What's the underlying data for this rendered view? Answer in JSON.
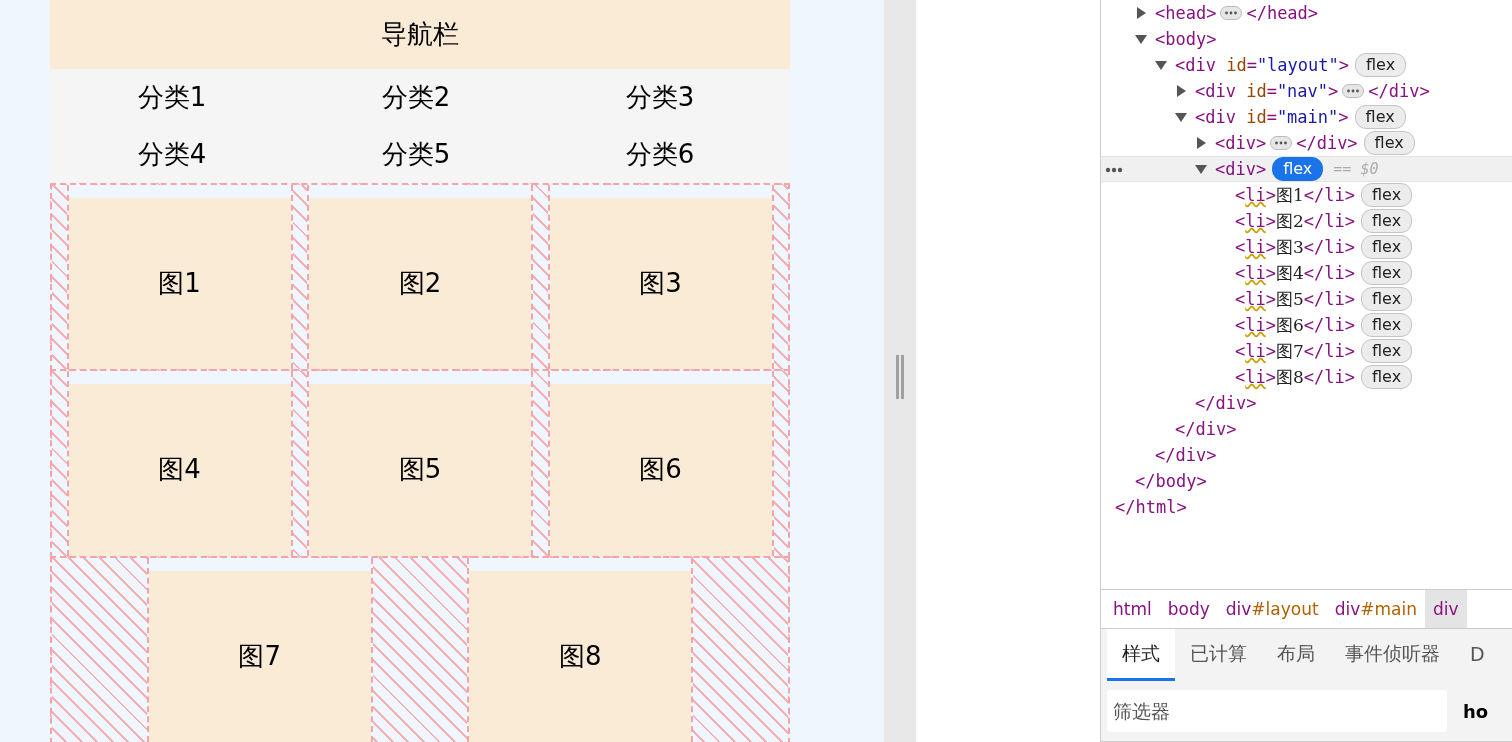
{
  "page": {
    "nav": {
      "title": "导航栏"
    },
    "categories": [
      "分类1",
      "分类2",
      "分类3",
      "分类4",
      "分类5",
      "分类6"
    ],
    "grid_rows": [
      {
        "items": [
          "图1",
          "图2",
          "图3"
        ]
      },
      {
        "items": [
          "图4",
          "图5",
          "图6"
        ]
      },
      {
        "items": [
          "图7",
          "图8"
        ]
      }
    ]
  },
  "devtools": {
    "dom_tree": [
      {
        "end": [
          {
            "t": "</html>",
            "kind": "tag"
          }
        ],
        "children": [
          {
            "open": [
              {
                "t": "<head>",
                "kind": "tag"
              }
            ],
            "expanded": false,
            "close": [
              {
                "t": "</head>",
                "kind": "tag"
              }
            ]
          },
          {
            "open": [
              {
                "t": "<body>",
                "kind": "tag"
              }
            ],
            "expanded": true,
            "end": [
              {
                "t": "</body>",
                "kind": "tag"
              }
            ],
            "children": [
              {
                "open": [
                  {
                    "t": "<div",
                    "kind": "tag"
                  },
                  {
                    "t": "id",
                    "kind": "attr"
                  },
                  {
                    "t": "=",
                    "kind": "tag"
                  },
                  {
                    "t": "\"layout\"",
                    "kind": "val"
                  },
                  {
                    "t": ">",
                    "kind": "tag"
                  }
                ],
                "badge": {
                  "label": "flex",
                  "selected": false
                },
                "expanded": true,
                "end": [
                  {
                    "t": "</div>",
                    "kind": "tag"
                  }
                ],
                "children": [
                  {
                    "open": [
                      {
                        "t": "<div",
                        "kind": "tag"
                      },
                      {
                        "t": "id",
                        "kind": "attr"
                      },
                      {
                        "t": "=",
                        "kind": "tag"
                      },
                      {
                        "t": "\"nav\"",
                        "kind": "val"
                      },
                      {
                        "t": ">",
                        "kind": "tag"
                      }
                    ],
                    "expanded": false,
                    "close": [
                      {
                        "t": "</div>",
                        "kind": "tag"
                      }
                    ]
                  },
                  {
                    "open": [
                      {
                        "t": "<div",
                        "kind": "tag"
                      },
                      {
                        "t": "id",
                        "kind": "attr"
                      },
                      {
                        "t": "=",
                        "kind": "tag"
                      },
                      {
                        "t": "\"main\"",
                        "kind": "val"
                      },
                      {
                        "t": ">",
                        "kind": "tag"
                      }
                    ],
                    "badge": {
                      "label": "flex",
                      "selected": false
                    },
                    "expanded": true,
                    "end": [
                      {
                        "t": "</div>",
                        "kind": "tag"
                      }
                    ],
                    "children": [
                      {
                        "open": [
                          {
                            "t": "<div>",
                            "kind": "tag"
                          }
                        ],
                        "expanded": false,
                        "close": [
                          {
                            "t": "</div>",
                            "kind": "tag"
                          }
                        ],
                        "badge": {
                          "label": "flex",
                          "selected": false
                        }
                      },
                      {
                        "open": [
                          {
                            "t": "<div>",
                            "kind": "tag"
                          }
                        ],
                        "badge": {
                          "label": "flex",
                          "selected": true
                        },
                        "ref": "== $0",
                        "selected": true,
                        "expanded": true,
                        "end": [
                          {
                            "t": "</div>",
                            "kind": "tag"
                          }
                        ],
                        "children": [
                          {
                            "open": [
                              {
                                "t": "<",
                                "kind": "tag"
                              },
                              {
                                "t": "li",
                                "kind": "tag",
                                "warn": true
                              },
                              {
                                "t": ">",
                                "kind": "tag"
                              },
                              {
                                "t": "图1",
                                "kind": "text"
                              },
                              {
                                "t": "</li>",
                                "kind": "tag"
                              }
                            ],
                            "badge": {
                              "label": "flex",
                              "selected": false
                            }
                          },
                          {
                            "open": [
                              {
                                "t": "<",
                                "kind": "tag"
                              },
                              {
                                "t": "li",
                                "kind": "tag",
                                "warn": true
                              },
                              {
                                "t": ">",
                                "kind": "tag"
                              },
                              {
                                "t": "图2",
                                "kind": "text"
                              },
                              {
                                "t": "</li>",
                                "kind": "tag"
                              }
                            ],
                            "badge": {
                              "label": "flex",
                              "selected": false
                            }
                          },
                          {
                            "open": [
                              {
                                "t": "<",
                                "kind": "tag"
                              },
                              {
                                "t": "li",
                                "kind": "tag",
                                "warn": true
                              },
                              {
                                "t": ">",
                                "kind": "tag"
                              },
                              {
                                "t": "图3",
                                "kind": "text"
                              },
                              {
                                "t": "</li>",
                                "kind": "tag"
                              }
                            ],
                            "badge": {
                              "label": "flex",
                              "selected": false
                            }
                          },
                          {
                            "open": [
                              {
                                "t": "<",
                                "kind": "tag"
                              },
                              {
                                "t": "li",
                                "kind": "tag",
                                "warn": true
                              },
                              {
                                "t": ">",
                                "kind": "tag"
                              },
                              {
                                "t": "图4",
                                "kind": "text"
                              },
                              {
                                "t": "</li>",
                                "kind": "tag"
                              }
                            ],
                            "badge": {
                              "label": "flex",
                              "selected": false
                            }
                          },
                          {
                            "open": [
                              {
                                "t": "<",
                                "kind": "tag"
                              },
                              {
                                "t": "li",
                                "kind": "tag",
                                "warn": true
                              },
                              {
                                "t": ">",
                                "kind": "tag"
                              },
                              {
                                "t": "图5",
                                "kind": "text"
                              },
                              {
                                "t": "</li>",
                                "kind": "tag"
                              }
                            ],
                            "badge": {
                              "label": "flex",
                              "selected": false
                            }
                          },
                          {
                            "open": [
                              {
                                "t": "<",
                                "kind": "tag"
                              },
                              {
                                "t": "li",
                                "kind": "tag",
                                "warn": true
                              },
                              {
                                "t": ">",
                                "kind": "tag"
                              },
                              {
                                "t": "图6",
                                "kind": "text"
                              },
                              {
                                "t": "</li>",
                                "kind": "tag"
                              }
                            ],
                            "badge": {
                              "label": "flex",
                              "selected": false
                            }
                          },
                          {
                            "open": [
                              {
                                "t": "<",
                                "kind": "tag"
                              },
                              {
                                "t": "li",
                                "kind": "tag",
                                "warn": true
                              },
                              {
                                "t": ">",
                                "kind": "tag"
                              },
                              {
                                "t": "图7",
                                "kind": "text"
                              },
                              {
                                "t": "</li>",
                                "kind": "tag"
                              }
                            ],
                            "badge": {
                              "label": "flex",
                              "selected": false
                            }
                          },
                          {
                            "open": [
                              {
                                "t": "<",
                                "kind": "tag"
                              },
                              {
                                "t": "li",
                                "kind": "tag",
                                "warn": true
                              },
                              {
                                "t": ">",
                                "kind": "tag"
                              },
                              {
                                "t": "图8",
                                "kind": "text"
                              },
                              {
                                "t": "</li>",
                                "kind": "tag"
                              }
                            ],
                            "badge": {
                              "label": "flex",
                              "selected": false
                            }
                          }
                        ]
                      }
                    ]
                  }
                ]
              }
            ]
          }
        ]
      }
    ],
    "breadcrumbs": [
      {
        "tag": "html",
        "selected": false
      },
      {
        "tag": "body",
        "selected": false
      },
      {
        "tag": "div",
        "id": "#layout",
        "selected": false
      },
      {
        "tag": "div",
        "id": "#main",
        "selected": false
      },
      {
        "tag": "div",
        "selected": true
      }
    ],
    "tabs": [
      {
        "label": "样式",
        "selected": true
      },
      {
        "label": "已计算",
        "selected": false
      },
      {
        "label": "布局",
        "selected": false
      },
      {
        "label": "事件侦听器",
        "selected": false
      },
      {
        "label": "D",
        "selected": false
      }
    ],
    "filter": {
      "placeholder": "筛选器"
    },
    "hov_button": "ho"
  }
}
